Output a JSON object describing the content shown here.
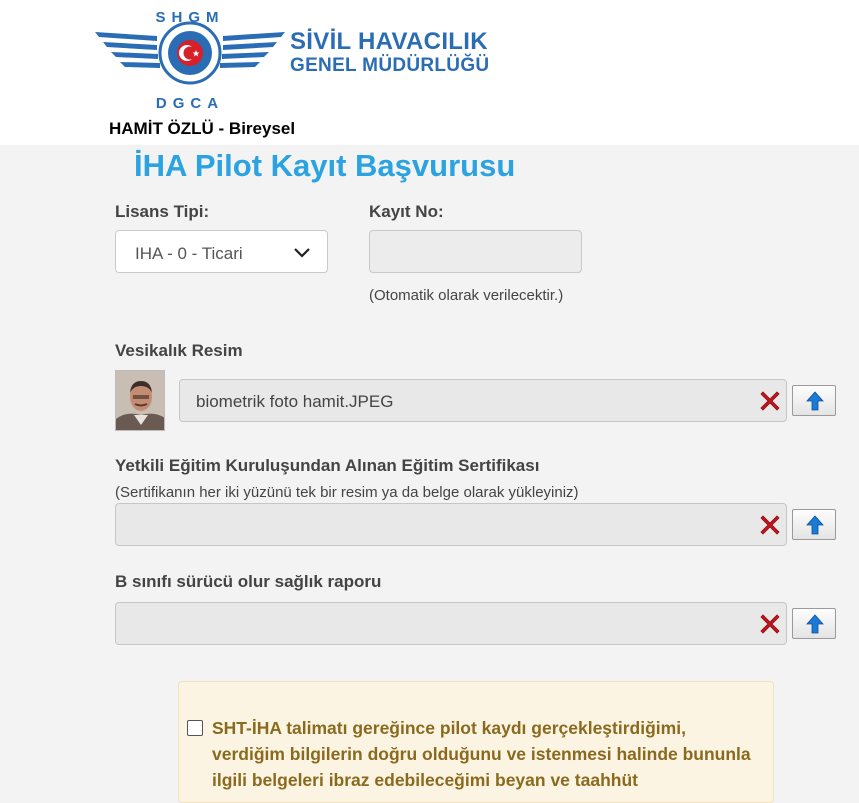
{
  "org": {
    "line1": "SİVİL HAVACILIK",
    "line2": "GENEL MÜDÜRLÜĞÜ",
    "logo_top": "SHGM",
    "logo_bottom": "DGCA"
  },
  "user_label": "HAMİT ÖZLÜ - Bireysel",
  "page_title": "İHA Pilot Kayıt Başvurusu",
  "license": {
    "label": "Lisans Tipi:",
    "selected": "IHA - 0 - Ticari"
  },
  "registration": {
    "label": "Kayıt No:",
    "value": "",
    "note": "(Otomatik olarak verilecektir.)"
  },
  "photo_section": {
    "label": "Vesikalık Resim",
    "file": "biometrik foto hamit.JPEG"
  },
  "certificate": {
    "label": "Yetkili Eğitim Kuruluşundan Alınan Eğitim Sertifikası",
    "hint": "(Sertifikanın her iki yüzünü tek bir resim ya da belge olarak yükleyiniz)",
    "file": ""
  },
  "health": {
    "label": "B sınıfı sürücü olur sağlık raporu",
    "file": ""
  },
  "consent": {
    "text": "SHT-İHA talimatı gereğince pilot kaydı gerçekleştirdiğimi, verdiğim bilgilerin doğru olduğunu ve istenmesi halinde bununla ilgili belgeleri ibraz edebileceğimi beyan ve taahhüt",
    "checked": false
  },
  "icons": {
    "delete": "red-x-icon",
    "upload": "upload-arrow-icon",
    "dropdown": "chevron-down-icon"
  },
  "colors": {
    "title": "#2ba3e0",
    "brand": "#2a6db5",
    "delete": "#c0161d",
    "consent_text": "#8a6a1e"
  }
}
